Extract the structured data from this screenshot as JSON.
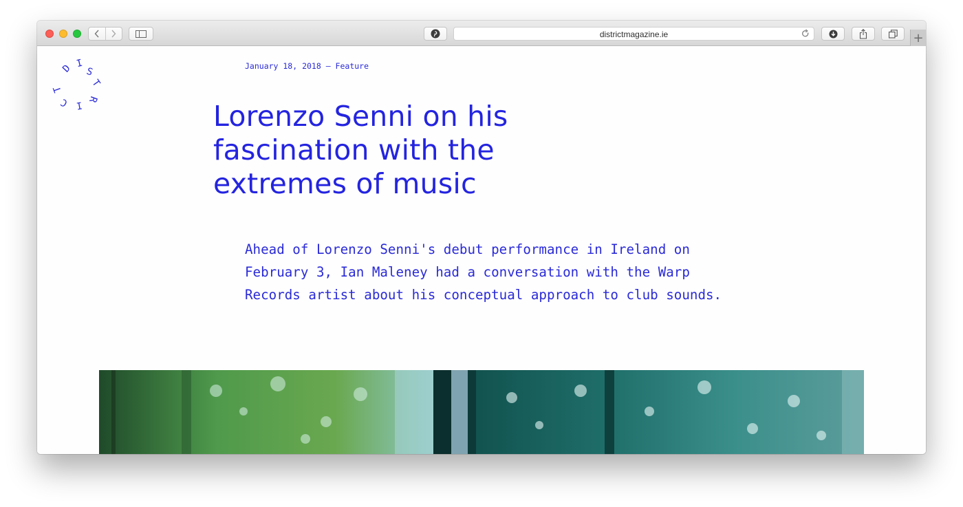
{
  "browser": {
    "url": "districtmagazine.ie",
    "new_tab_label": "+"
  },
  "site": {
    "logo_letters": [
      "D",
      "I",
      "S",
      "T",
      "R",
      "I",
      "C",
      "T"
    ]
  },
  "article": {
    "meta": "January 18, 2018 — Feature",
    "title": "Lorenzo Senni on his fascination with the extremes of music",
    "lede": "Ahead of Lorenzo Senni's debut performance in Ireland on February 3, Ian Maleney had a conversation with the Warp Records artist about his conceptual approach to club sounds."
  },
  "colors": {
    "accent": "#2424e0"
  },
  "icons": {
    "back": "chevron-left-icon",
    "forward": "chevron-right-icon",
    "sidebar": "sidebar-icon",
    "pinterest": "pinterest-icon",
    "reload": "reload-icon",
    "download": "download-icon",
    "share": "share-icon",
    "tabs": "tabs-overview-icon",
    "new_tab": "plus-icon"
  }
}
